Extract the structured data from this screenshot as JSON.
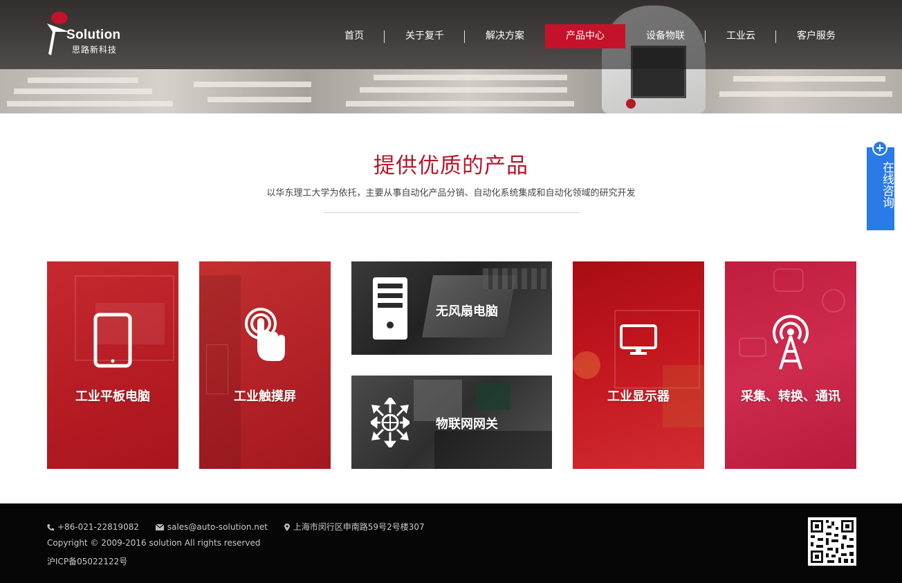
{
  "brand": {
    "wordmark": "Solution",
    "name_cn": "思路新科技"
  },
  "nav": {
    "items": [
      {
        "label": "首页"
      },
      {
        "label": "关于复千"
      },
      {
        "label": "解决方案"
      },
      {
        "label": "产品中心"
      },
      {
        "label": "设备物联"
      },
      {
        "label": "工业云"
      },
      {
        "label": "客户服务"
      }
    ],
    "active_label": "产品中心"
  },
  "intro": {
    "title": "提供优质的产品",
    "subtitle": "以华东理工大学为依托，主要从事自动化产品分销、自动化系统集成和自动化领域的研究开发"
  },
  "products": [
    {
      "label": "工业平板电脑",
      "icon": "tablet-icon",
      "color": "#c01e27"
    },
    {
      "label": "工业触摸屏",
      "icon": "touch-icon",
      "color": "#b7262a"
    },
    {
      "label": "无风扇电脑",
      "icon": "pc-tower-icon",
      "color": "#2a2a2a"
    },
    {
      "label": "物联网网关",
      "icon": "network-gateway-icon",
      "color": "#3a3a3a"
    },
    {
      "label": "工业显示器",
      "icon": "monitor-icon",
      "color": "#c3161f"
    },
    {
      "label": "采集、转换、通讯",
      "icon": "signal-tower-icon",
      "color": "#c8234a"
    }
  ],
  "consult": {
    "label": "在线咨询"
  },
  "footer": {
    "phone": "+86-021-22819082",
    "email": "sales@auto-solution.net",
    "address": "上海市闵行区申南路59号2号楼307",
    "copyright": "Copyright © 2009-2016 solution All rights reserved",
    "icp": "沪ICP备05022122号"
  },
  "colors": {
    "accent": "#c4122b",
    "consult": "#2a7ae8",
    "footer_bg": "#060606"
  }
}
